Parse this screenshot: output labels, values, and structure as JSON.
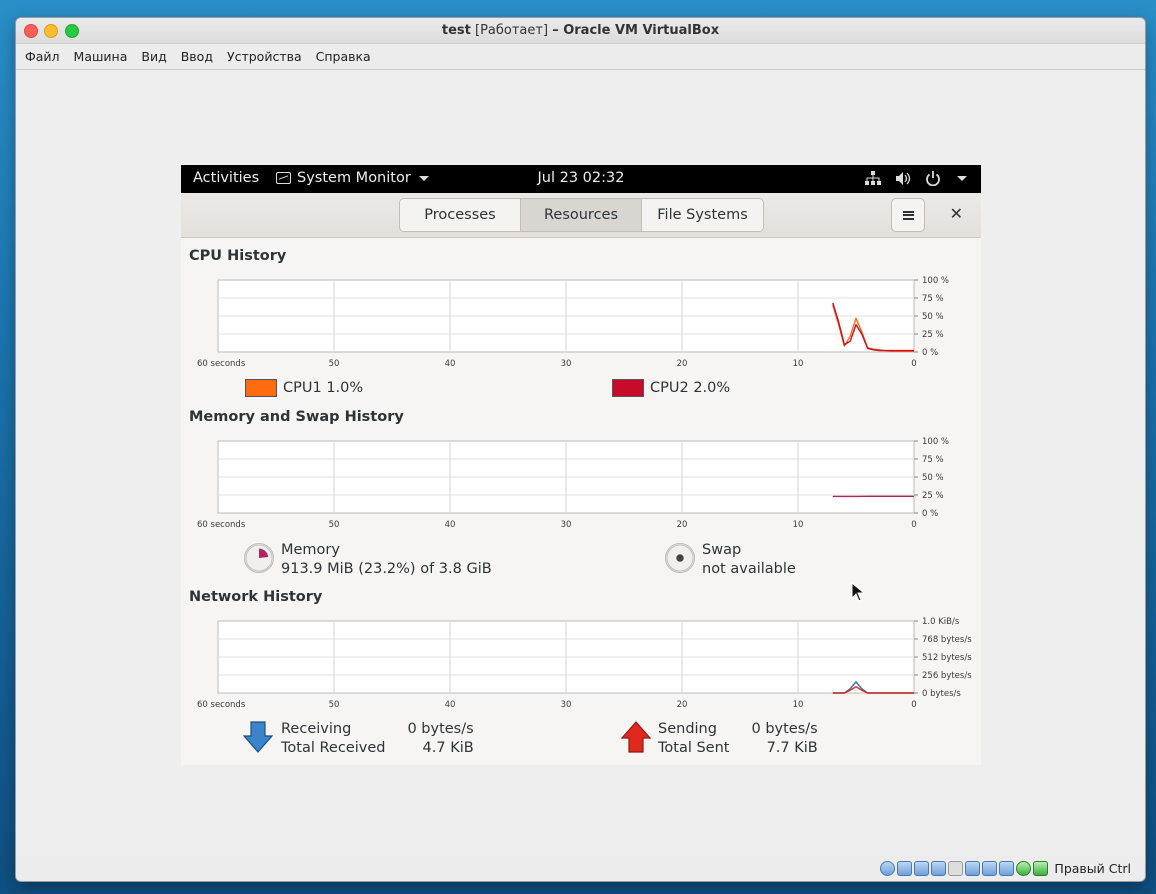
{
  "host": {
    "title_prefix": "test",
    "title_state": "[Работает]",
    "title_suffix": "– Oracle VM VirtualBox",
    "menu": [
      "Файл",
      "Машина",
      "Вид",
      "Ввод",
      "Устройства",
      "Справка"
    ],
    "status_host_key": "Правый Ctrl"
  },
  "gnome": {
    "activities": "Activities",
    "app_menu": "System Monitor",
    "clock": "Jul 23  02:32"
  },
  "header": {
    "tabs": [
      "Processes",
      "Resources",
      "File Systems"
    ],
    "active_tab": "Resources"
  },
  "cpu": {
    "title": "CPU History",
    "y_ticks": [
      "100 %",
      "75 %",
      "50 %",
      "25 %",
      "0 %"
    ],
    "legend": [
      {
        "label": "CPU1",
        "value": "1.0%",
        "color": "#fc6c0f"
      },
      {
        "label": "CPU2",
        "value": "2.0%",
        "color": "#c70c2b"
      }
    ]
  },
  "memory": {
    "title": "Memory and Swap History",
    "y_ticks": [
      "100 %",
      "75 %",
      "50 %",
      "25 %",
      "0 %"
    ],
    "memory_label": "Memory",
    "memory_value": "913.9 MiB (23.2%) of 3.8 GiB",
    "memory_fraction": 0.232,
    "memory_color": "#b0265e",
    "swap_label": "Swap",
    "swap_value": "not available"
  },
  "network": {
    "title": "Network History",
    "y_ticks": [
      "1.0 KiB/s",
      "768 bytes/s",
      "512 bytes/s",
      "256 bytes/s",
      "0 bytes/s"
    ],
    "receiving_label": "Receiving",
    "receiving_value": "0 bytes/s",
    "total_received_label": "Total Received",
    "total_received_value": "4.7 KiB",
    "sending_label": "Sending",
    "sending_value": "0 bytes/s",
    "total_sent_label": "Total Sent",
    "total_sent_value": "7.7 KiB",
    "receive_color": "#2d6db4",
    "send_color": "#d72a1e"
  },
  "x_ticks": [
    "60 seconds",
    "50",
    "40",
    "30",
    "20",
    "10",
    "0"
  ],
  "chart_data": [
    {
      "type": "line",
      "title": "CPU History",
      "x": [
        7,
        6.5,
        6,
        5.5,
        5,
        4.5,
        4,
        3.5,
        3,
        2.5,
        2,
        1.5,
        1,
        0.5,
        0
      ],
      "xlim": [
        60,
        0
      ],
      "ylim": [
        0,
        100
      ],
      "series": [
        {
          "name": "CPU1",
          "values": [
            65,
            38,
            8,
            22,
            47,
            28,
            6,
            4,
            3,
            2,
            1,
            1,
            1,
            1,
            1
          ]
        },
        {
          "name": "CPU2",
          "values": [
            68,
            42,
            10,
            15,
            38,
            25,
            5,
            3,
            2,
            2,
            2,
            2,
            2,
            2,
            2
          ]
        }
      ]
    },
    {
      "type": "line",
      "title": "Memory and Swap History",
      "x": [
        7,
        6,
        5,
        4,
        3,
        2,
        1,
        0
      ],
      "xlim": [
        60,
        0
      ],
      "ylim": [
        0,
        100
      ],
      "series": [
        {
          "name": "Memory",
          "values": [
            23,
            23,
            23.1,
            23.2,
            23.2,
            23.2,
            23.2,
            23.2
          ]
        }
      ]
    },
    {
      "type": "line",
      "title": "Network History",
      "x": [
        7,
        6,
        5.5,
        5,
        4.5,
        4,
        3,
        2,
        1,
        0
      ],
      "xlim": [
        60,
        0
      ],
      "ylim": [
        0,
        1024
      ],
      "series": [
        {
          "name": "Receiving",
          "values": [
            0,
            0,
            60,
            160,
            60,
            0,
            0,
            0,
            0,
            0
          ]
        },
        {
          "name": "Sending",
          "values": [
            0,
            0,
            40,
            90,
            40,
            0,
            0,
            0,
            0,
            0
          ]
        }
      ]
    }
  ]
}
